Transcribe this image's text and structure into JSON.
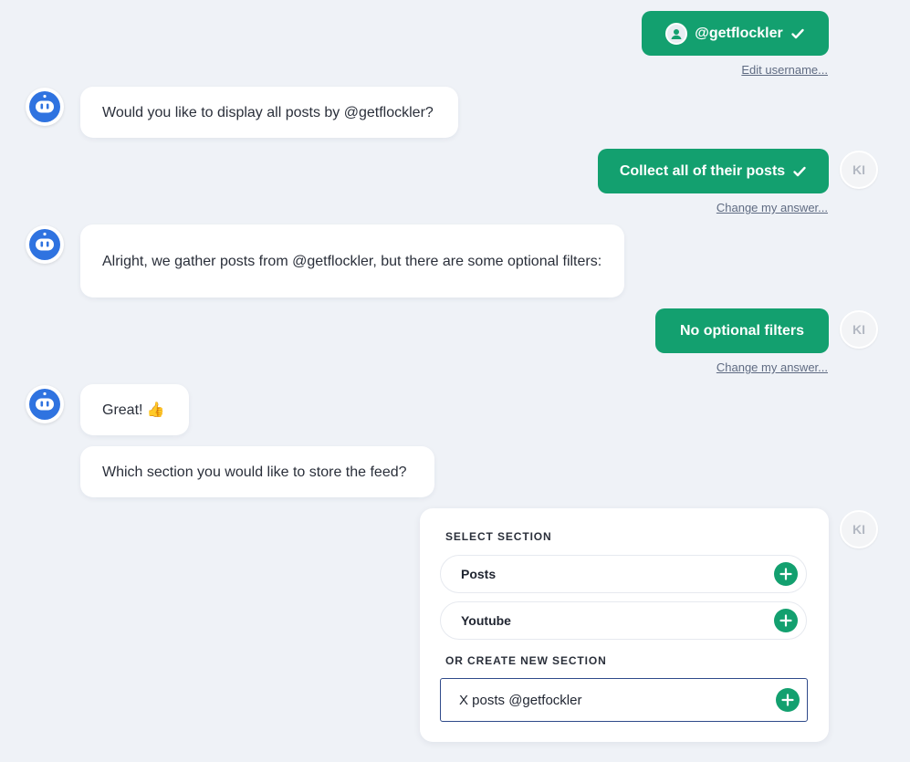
{
  "username_answer": {
    "label": "@getflockler",
    "edit_link": "Edit username..."
  },
  "bot_messages": {
    "display_all": "Would you like to display all posts by @getflockler?",
    "filters": "Alright, we gather posts from @getflockler, but there are some optional filters:",
    "great": "Great! 👍",
    "which_section": "Which section you would like to store the feed?"
  },
  "user_answers": {
    "collect": "Collect all of their posts",
    "no_filters": "No optional filters",
    "change_link": "Change my answer..."
  },
  "user_initials": "KI",
  "section_panel": {
    "select_heading": "SELECT SECTION",
    "options": [
      {
        "label": "Posts"
      },
      {
        "label": "Youtube"
      }
    ],
    "create_heading": "OR CREATE NEW SECTION",
    "new_section_value": "X posts @getfockler"
  },
  "colors": {
    "accent": "#13a06f",
    "bot_blue": "#2f73e0",
    "background": "#eff2f7"
  },
  "icons": [
    "check-icon",
    "user-avatar-icon",
    "bot-avatar-icon",
    "plus-icon"
  ]
}
